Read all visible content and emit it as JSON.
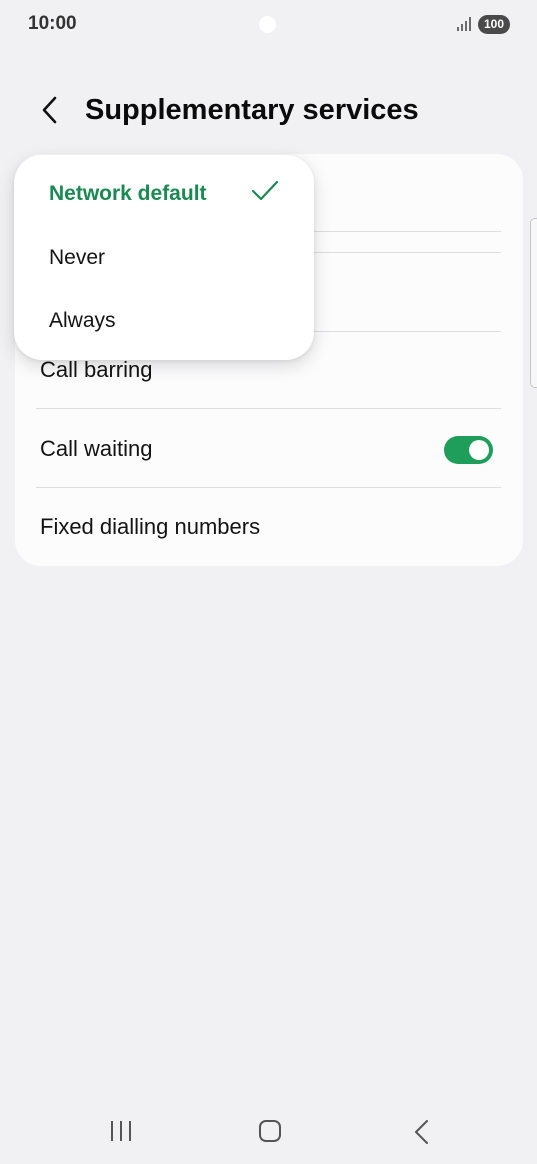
{
  "status_bar": {
    "time": "10:00",
    "battery": "100",
    "signal_icon": "signal-bars-icon"
  },
  "header": {
    "title": "Supplementary services",
    "back_icon": "chevron-left-icon"
  },
  "settings": {
    "rows": [
      {
        "label": "Call barring"
      },
      {
        "label": "Call waiting",
        "toggle_on": true
      },
      {
        "label": "Fixed dialling numbers"
      }
    ]
  },
  "dropdown": {
    "options": [
      {
        "label": "Network default",
        "selected": true
      },
      {
        "label": "Never",
        "selected": false
      },
      {
        "label": "Always",
        "selected": false
      }
    ],
    "check_icon": "checkmark-icon"
  },
  "nav_bar": {
    "recent_icon": "recent-apps-icon",
    "home_icon": "home-icon",
    "back_icon": "back-icon"
  },
  "colors": {
    "accent": "#1e9e5a",
    "selected_text": "#1a8a52",
    "background": "#f1f1f3",
    "card": "#fcfcfd"
  }
}
